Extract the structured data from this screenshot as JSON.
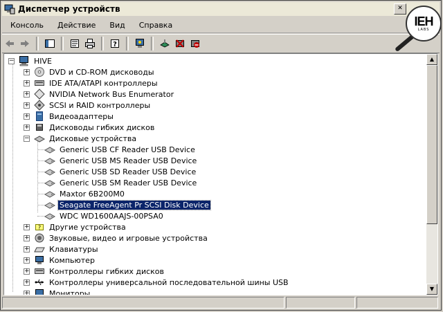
{
  "window": {
    "title": "Диспетчер устройств"
  },
  "menu": [
    "Консоль",
    "Действие",
    "Вид",
    "Справка"
  ],
  "logo": {
    "text": "IEH",
    "sub": "LABS"
  },
  "tree": {
    "root": "HIVE",
    "categories": [
      {
        "label": "DVD и CD-ROM дисководы",
        "expander": "+",
        "icon": "cdrom-icon"
      },
      {
        "label": "IDE ATA/ATAPI контроллеры",
        "expander": "+",
        "icon": "ide-controller-icon"
      },
      {
        "label": "NVIDIA Network Bus Enumerator",
        "expander": "+",
        "icon": "network-bus-icon"
      },
      {
        "label": "SCSI и RAID контроллеры",
        "expander": "+",
        "icon": "scsi-controller-icon"
      },
      {
        "label": "Видеоадаптеры",
        "expander": "+",
        "icon": "display-adapter-icon"
      },
      {
        "label": "Дисководы гибких дисков",
        "expander": "+",
        "icon": "floppy-drive-icon"
      },
      {
        "label": "Дисковые устройства",
        "expander": "−",
        "icon": "disk-drives-icon"
      }
    ],
    "disks": [
      "Generic USB CF Reader USB Device",
      "Generic USB MS Reader USB Device",
      "Generic USB SD Reader USB Device",
      "Generic USB SM Reader USB Device",
      "Maxtor 6B200M0",
      "Seagate FreeAgent Pr SCSI Disk Device",
      "WDC WD1600AAJS-00PSA0"
    ],
    "selected_disk": "Seagate FreeAgent Pr SCSI Disk Device",
    "categories2": [
      {
        "label": "Другие устройства",
        "expander": "+",
        "icon": "unknown-device-icon"
      },
      {
        "label": "Звуковые, видео и игровые устройства",
        "expander": "+",
        "icon": "sound-device-icon"
      },
      {
        "label": "Клавиатуры",
        "expander": "+",
        "icon": "keyboard-icon"
      },
      {
        "label": "Компьютер",
        "expander": "+",
        "icon": "computer-icon"
      },
      {
        "label": "Контроллеры гибких дисков",
        "expander": "+",
        "icon": "floppy-controller-icon"
      },
      {
        "label": "Контроллеры универсальной последовательной шины USB",
        "expander": "+",
        "icon": "usb-controller-icon"
      },
      {
        "label": "Мониторы",
        "expander": "+",
        "icon": "monitor-icon"
      }
    ]
  },
  "colors": {
    "selection": "#0a246a",
    "face": "#d4d0c8"
  }
}
